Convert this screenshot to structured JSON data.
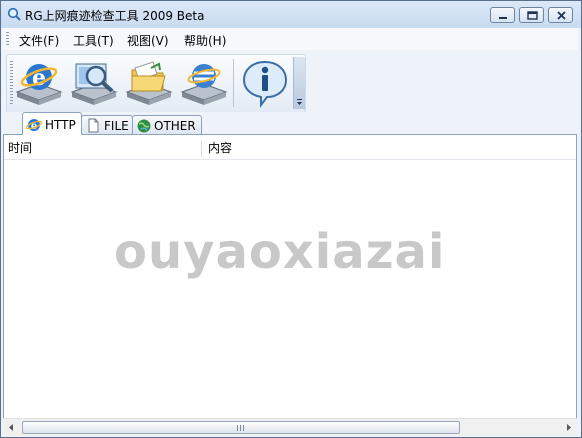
{
  "window": {
    "title": "RG上网痕迹检查工具 2009 Beta",
    "app_icon": "magnifier-icon",
    "controls": [
      "minimize-icon",
      "maximize-icon",
      "close-icon"
    ]
  },
  "menu": {
    "items": [
      {
        "label": "文件(F)"
      },
      {
        "label": "工具(T)"
      },
      {
        "label": "视图(V)"
      },
      {
        "label": "帮助(H)"
      }
    ]
  },
  "toolbar": {
    "buttons": [
      {
        "icon": "ie-browser-drive-icon"
      },
      {
        "icon": "search-drive-icon"
      },
      {
        "icon": "folder-drive-icon"
      },
      {
        "icon": "other-browser-drive-icon"
      },
      {
        "icon": "info-icon"
      }
    ]
  },
  "tabs": [
    {
      "label": "HTTP",
      "icon": "ie-icon",
      "active": true
    },
    {
      "label": "FILE",
      "icon": "file-icon",
      "active": false
    },
    {
      "label": "OTHER",
      "icon": "globe-icon",
      "active": false
    }
  ],
  "table": {
    "columns": [
      "时间",
      "内容"
    ],
    "rows": []
  },
  "watermark": "ouyaoxiazai",
  "colors": {
    "titlebar": "#c9dbf1",
    "window_bg": "#eef3fa",
    "watermark": "#c8c8c8"
  }
}
